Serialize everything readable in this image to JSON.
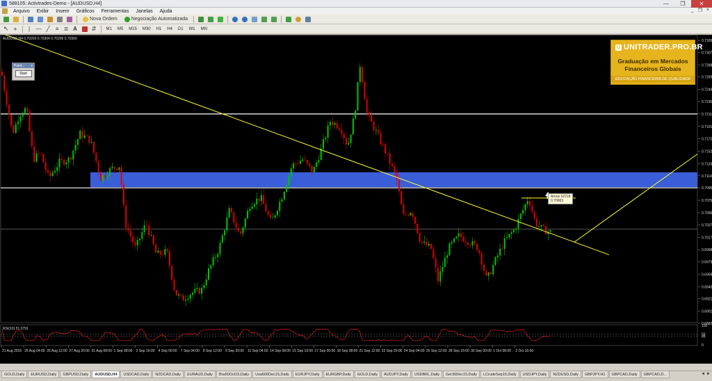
{
  "window": {
    "title": "588105: Activtrades-Demo - [AUDUSD,H4]",
    "minimize": "—",
    "maximize": "❐",
    "close": "✕"
  },
  "menu": {
    "items": [
      "Arquivo",
      "Exibir",
      "Inserir",
      "Gráficos",
      "Ferramentas",
      "Janelas",
      "Ajuda"
    ],
    "mdi_minimize": "_",
    "mdi_restore": "❐",
    "mdi_close": "×"
  },
  "toolbar1": {
    "new_order_label": "Nova Ordem",
    "auto_trading_label": "Negociação Automatizada"
  },
  "toolbar2": {
    "timeframes": [
      "M1",
      "M5",
      "M15",
      "M30",
      "H1",
      "H4",
      "D1",
      "W1",
      "MN"
    ]
  },
  "chart": {
    "symbol_info": "AUDUSD,H4  0.70209 0.70304 0.70205 0.70300",
    "price_labels": [
      "0.73265",
      "0.73075",
      "0.72880",
      "0.72690",
      "0.72495",
      "0.72305",
      "0.72110",
      "0.71915",
      "0.71720",
      "0.71525",
      "0.71330",
      "0.71140",
      "0.70950",
      "0.70755",
      "0.70560",
      "0.70370",
      "0.70175",
      "0.69980",
      "0.69790",
      "0.69595",
      "0.69400",
      "0.69210",
      "0.69015",
      "0.68825"
    ],
    "time_labels": [
      "21 Aug 2015",
      "25 Aug 04:00",
      "26 Aug 12:00",
      "27 Aug 20:00",
      "31 Aug 08:00",
      "1 Sep 08:00",
      "2 Sep 16:00",
      "4 Sep 00:00",
      "7 Sep 04:00",
      "8 Sep 12:00",
      "9 Sep 20:00",
      "11 Sep 04:00",
      "14 Sep 08:00",
      "15 Sep 16:00",
      "17 Sep 00:00",
      "18 Sep 08:00",
      "21 Sep 12:00",
      "22 Sep 20:00",
      "24 Sep 04:00",
      "25 Sep 12:00",
      "28 Sep 16:00",
      "30 Sep 00:00",
      "1 Oct 08:00",
      "2 Oct 16:00"
    ],
    "rsi_label": "RSI(10) 51.0791",
    "rsi_levels": [
      "100",
      "55",
      "45",
      "0"
    ],
    "ea_panel_title": "Point...",
    "ea_panel_close": "x",
    "ea_start_label": "Start",
    "arrow_tooltip_line1": "Arrow 52218",
    "arrow_tooltip_line2": "0.70963",
    "colors": {
      "bull": "#00c800",
      "bear": "#e00000",
      "trend": "#ffff30",
      "zone": "#3a5ed8",
      "sr_line": "#ffffff"
    }
  },
  "logo": {
    "brand": "UNITRADER.PRO.BR",
    "brand_mark": "U",
    "line1": "Graduação em Mercados",
    "line2": "Financeiros Globais",
    "tagline": "EDUCAÇÃO FINANCEIRA DE QUALIDADE"
  },
  "tabs": {
    "items": [
      "GOLD,Daily",
      "EURUSD,Daily",
      "GBPUSD,Daily",
      "AUDUSD,H4",
      "USDCAD,Daily",
      "NZDCAD,Daily",
      "EURAUD,Daily",
      "Bra50Oct15,Daily",
      "Usa500Dec15,Daily",
      "EURJPY,Daily",
      "EURGBP,Daily",
      "GOLD,Daily",
      "AUDJPY,Daily",
      "USDBRL,Daily",
      "Ger30Dec15,Daily",
      "LCrudeSep15,Daily",
      "USDJPY,Daily",
      "NZDUSD,Daily",
      "GBPJPY,H1",
      "GBPCAD,Daily",
      "GBPCAD,D..."
    ],
    "active_index": 3,
    "scroll_left": "◄",
    "scroll_right": "►"
  }
}
